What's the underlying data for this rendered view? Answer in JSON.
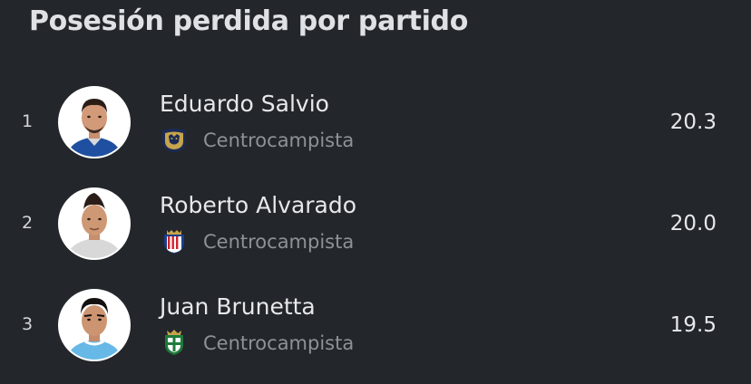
{
  "header": {
    "title": "Posesión perdida por partido"
  },
  "players": [
    {
      "rank": "1",
      "name": "Eduardo Salvio",
      "position": "Centrocampista",
      "value": "20.3",
      "team_icon": "pumas-badge-icon",
      "jersey_color": "#1f4fa0"
    },
    {
      "rank": "2",
      "name": "Roberto Alvarado",
      "position": "Centrocampista",
      "value": "20.0",
      "team_icon": "chivas-badge-icon",
      "jersey_color": "#d8d8d8"
    },
    {
      "rank": "3",
      "name": "Juan Brunetta",
      "position": "Centrocampista",
      "value": "19.5",
      "team_icon": "santos-badge-icon",
      "jersey_color": "#66b8e6"
    }
  ]
}
